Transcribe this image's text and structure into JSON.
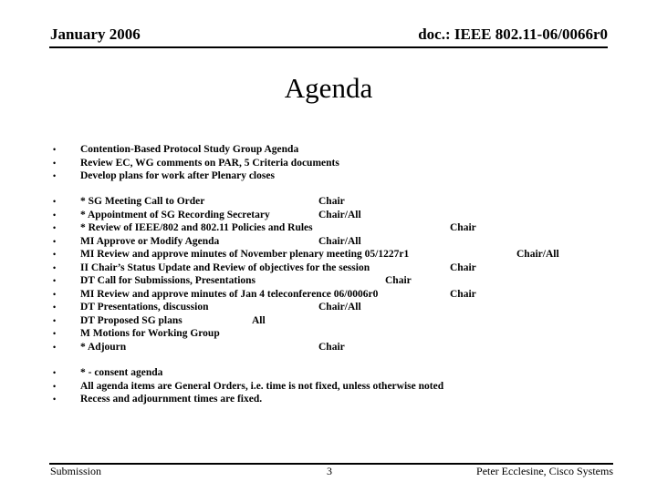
{
  "header": {
    "date": "January 2006",
    "doc_id": "doc.: IEEE 802.11-06/0066r0"
  },
  "title": "Agenda",
  "bullet_glyph": "•",
  "intro_items": [
    "Contention-Based Protocol Study Group Agenda",
    "Review EC, WG comments on PAR, 5 Criteria documents",
    "Develop plans for work after Plenary closes"
  ],
  "agenda_items": [
    {
      "text": "* SG Meeting Call to Order",
      "role": "Chair"
    },
    {
      "text": "* Appointment of SG Recording Secretary",
      "role": "Chair/All"
    },
    {
      "text": "* Review of IEEE/802 and 802.11 Policies and Rules",
      "role": "Chair"
    },
    {
      "text": "MI Approve or Modify Agenda",
      "role": "Chair/All"
    },
    {
      "text": "MI Review and approve minutes of November plenary meeting 05/1227r1",
      "role": "Chair/All"
    },
    {
      "text": "II Chair’s Status Update and Review of objectives for the session",
      "role": "Chair"
    },
    {
      "text": "DT Call for Submissions, Presentations",
      "role": "Chair"
    },
    {
      "text": "MI Review and approve minutes of Jan 4 teleconference 06/0006r0",
      "role": "Chair"
    },
    {
      "text": "DT Presentations, discussion",
      "role": "Chair/All"
    },
    {
      "text": "DT Proposed SG plans",
      "role": "All"
    },
    {
      "text": "M Motions for Working Group",
      "role": ""
    },
    {
      "text": "* Adjourn",
      "role": "Chair"
    }
  ],
  "notes": [
    "* - consent agenda",
    "All agenda items are General Orders, i.e. time is not fixed, unless otherwise noted",
    "Recess and adjournment times are fixed."
  ],
  "footer": {
    "left": "Submission",
    "page_number": "3",
    "right": "Peter Ecclesine, Cisco Systems"
  }
}
